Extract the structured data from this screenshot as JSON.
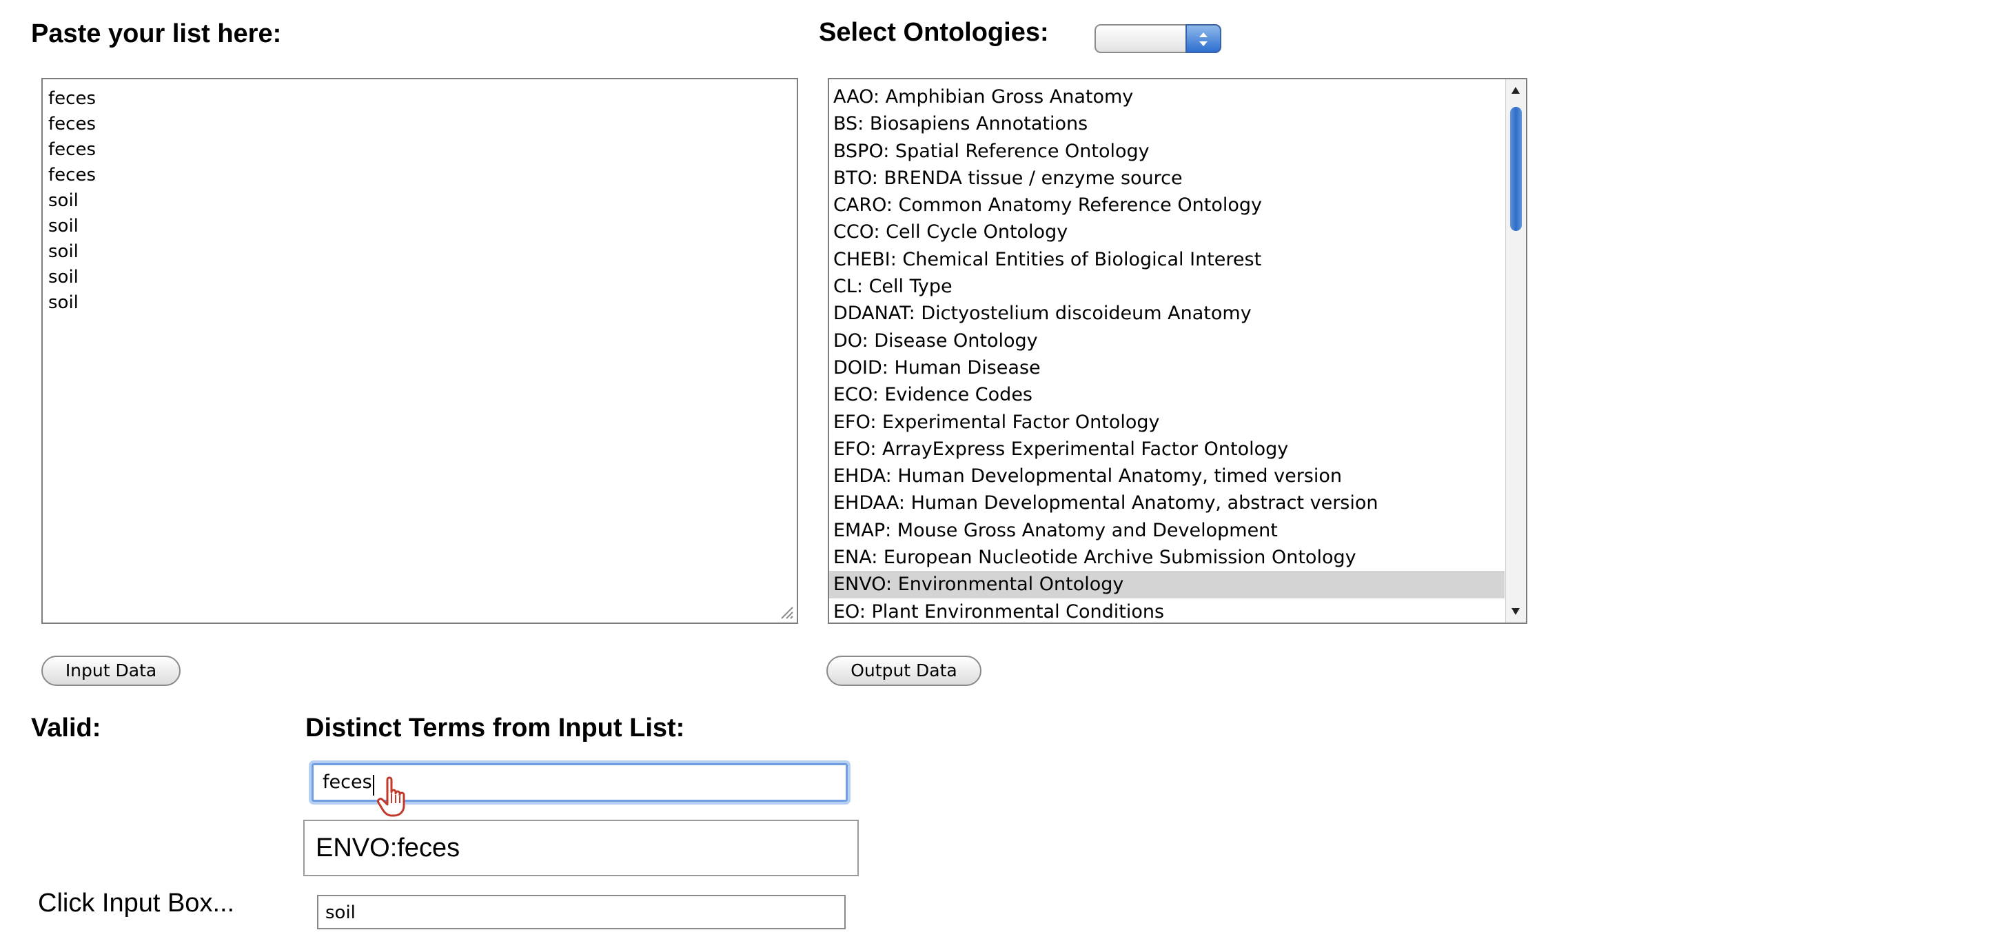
{
  "headings": {
    "paste": "Paste your list here:",
    "select_ontologies": "Select Ontologies:",
    "valid": "Valid:",
    "distinct_terms": "Distinct Terms from Input List:"
  },
  "paste_list": {
    "lines": [
      "feces",
      "feces",
      "feces",
      "feces",
      "soil",
      "soil",
      "soil",
      "soil",
      "soil"
    ]
  },
  "ontology_dropdown": {
    "selected_value": "",
    "icon": "up-down-arrows-icon"
  },
  "ontology_list": {
    "items": [
      "AAO: Amphibian Gross Anatomy",
      "BS: Biosapiens Annotations",
      "BSPO: Spatial Reference Ontology",
      "BTO: BRENDA tissue / enzyme source",
      "CARO: Common Anatomy Reference Ontology",
      "CCO: Cell Cycle Ontology",
      "CHEBI: Chemical Entities of Biological Interest",
      "CL: Cell Type",
      "DDANAT: Dictyostelium discoideum Anatomy",
      "DO: Disease Ontology",
      "DOID: Human Disease",
      "ECO: Evidence Codes",
      "EFO: Experimental Factor Ontology",
      "EFO: ArrayExpress Experimental Factor Ontology",
      "EHDA: Human Developmental Anatomy, timed version",
      "EHDAA: Human Developmental Anatomy, abstract version",
      "EMAP: Mouse Gross Anatomy and Development",
      "ENA: European Nucleotide Archive Submission Ontology",
      "ENVO: Environmental Ontology",
      "EO: Plant Environmental Conditions"
    ],
    "selected": "ENVO: Environmental Ontology",
    "selection_color": "#d4d4d4",
    "scroll_position": 0.06
  },
  "buttons": {
    "input_data": "Input Data",
    "output_data": "Output Data"
  },
  "term_input": {
    "value": "feces",
    "focus_color": "#6f9ee2"
  },
  "suggestion": {
    "text": "ENVO:feces"
  },
  "click_hint": "Click Input Box...",
  "soil_input": {
    "value": "soil"
  },
  "accent_color": "#2f6cc6"
}
